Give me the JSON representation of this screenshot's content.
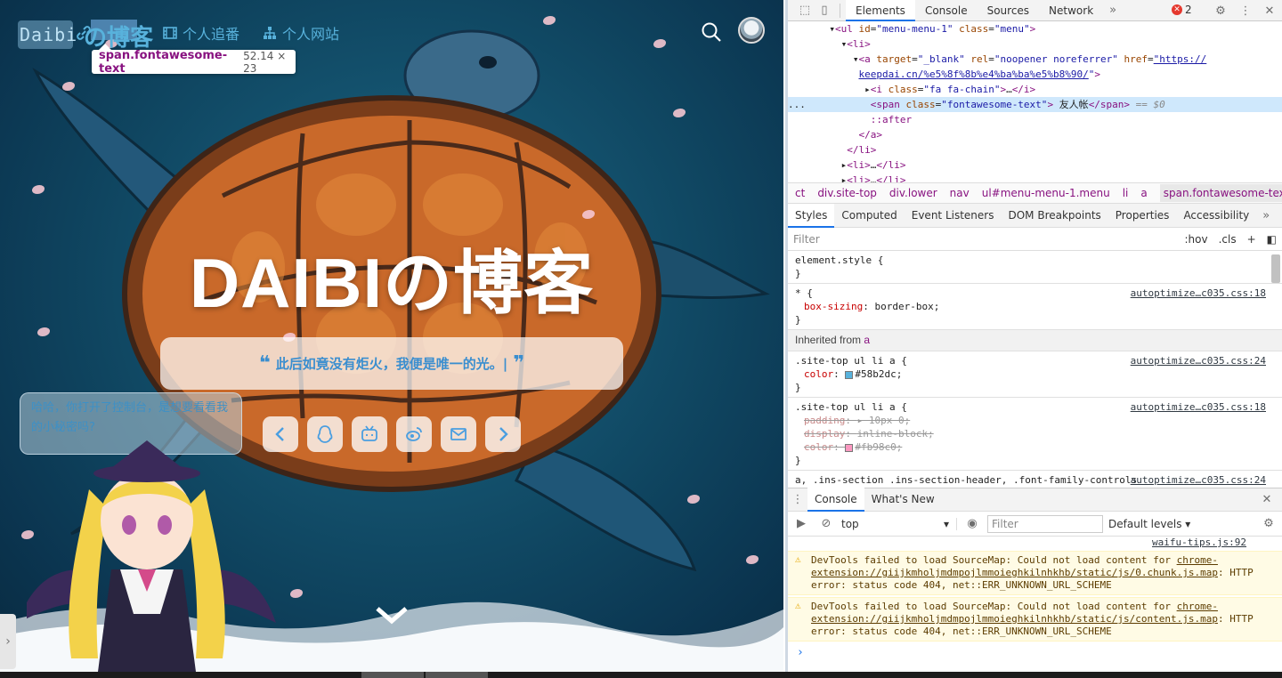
{
  "blog": {
    "logo_text": "Daibi",
    "site_title_small": "の博客",
    "menu": [
      {
        "label": "友人帐",
        "icon": "link-chain-icon"
      },
      {
        "label": "个人追番",
        "icon": "film-icon"
      },
      {
        "label": "个人网站",
        "icon": "sitemap-icon"
      }
    ],
    "tooltip": {
      "selector": "span.fontawesome-text",
      "size": "52.14 × 23"
    },
    "hero_title": "DAIBIの博客",
    "quote": "此后如竟没有炬火，我便是唯一的光。|",
    "bubble_text": "哈哈，你打开了控制台，是想要看看我的小秘密吗?",
    "social_icons": [
      "chevron-left-icon",
      "qq-icon",
      "bilibili-icon",
      "weibo-icon",
      "mail-icon",
      "chevron-right-icon"
    ]
  },
  "devtools": {
    "tabs": [
      "Elements",
      "Console",
      "Sources",
      "Network"
    ],
    "active_tab": "Elements",
    "error_count": "2",
    "breadcrumbs": [
      "ct",
      "div.site-top",
      "div.lower",
      "nav",
      "ul#menu-menu-1.menu",
      "li",
      "a",
      "span.fontawesome-text"
    ],
    "styles_tabs": [
      "Styles",
      "Computed",
      "Event Listeners",
      "DOM Breakpoints",
      "Properties",
      "Accessibility"
    ],
    "filter_placeholder": "Filter",
    "hov": ":hov",
    "cls": ".cls",
    "element_style": "element.style {",
    "inherited_label": "Inherited from",
    "inherited_tag": "a",
    "rules": [
      {
        "selector": "* {",
        "source": "autoptimize…c035.css:18",
        "props": [
          {
            "name": "box-sizing",
            "value": "border-box;"
          }
        ]
      },
      {
        "selector": ".site-top ul li a {",
        "source": "autoptimize…c035.css:24",
        "props": [
          {
            "name": "color",
            "value": "#58b2dc;",
            "swatch": "#58b2dc"
          }
        ]
      },
      {
        "selector": ".site-top ul li a {",
        "source": "autoptimize…c035.css:18",
        "props": [
          {
            "name": "padding",
            "value": "▸ 10px 0;",
            "struck": true
          },
          {
            "name": "display",
            "value": "inline-block;",
            "struck": true
          },
          {
            "name": "color",
            "value": "#fb98c0;",
            "swatch": "#fb98c0",
            "struck": true
          }
        ]
      }
    ],
    "last_rule_selector": "a, .ins-section .ins-section-header, .font-family-controls button, .menu-list li, .ins-section .ins-search-item, .ins-section",
    "last_rule_source": "autoptimize…c035.css:24",
    "console_tabs": [
      "Console",
      "What's New"
    ],
    "console_context": "top",
    "console_filter": "Filter",
    "console_levels": "Default levels",
    "source_link": "waifu-tips.js:92",
    "warnings": [
      {
        "text1": "DevTools failed to load SourceMap: Could not load content for ",
        "link": "chrome-extension://giijkmholjmdmpojlmmoieghkilnhkhb/static/js/0.chunk.js.map",
        "text2": ": HTTP error: status code 404, net::ERR_UNKNOWN_URL_SCHEME"
      },
      {
        "text1": "DevTools failed to load SourceMap: Could not load content for ",
        "link": "chrome-extension://giijkmholjmdmpojlmmoieghkilnhkhb/static/js/content.js.map",
        "text2": ": HTTP error: status code 404, net::ERR_UNKNOWN_URL_SCHEME"
      }
    ]
  }
}
